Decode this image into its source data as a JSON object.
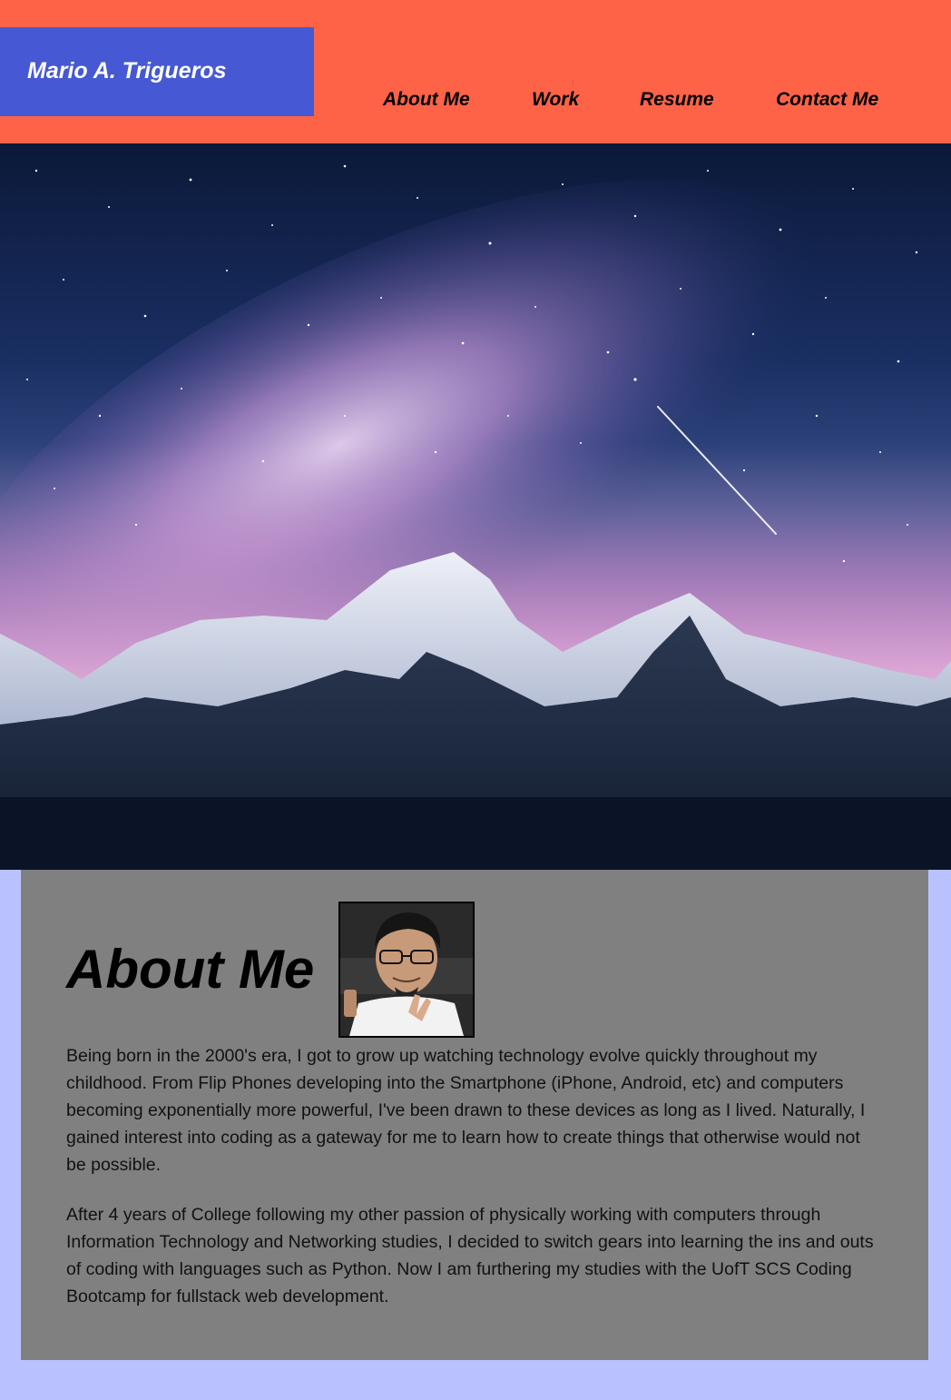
{
  "header": {
    "brand": "Mario A. Trigueros",
    "nav": [
      {
        "label": "About Me"
      },
      {
        "label": "Work"
      },
      {
        "label": "Resume"
      },
      {
        "label": "Contact Me"
      }
    ],
    "colors": {
      "header_bg": "#ff6347",
      "brand_bg": "#4658d3",
      "brand_text": "#ffffff",
      "nav_text": "#000000"
    }
  },
  "hero": {
    "image": "starry-night-mountains-image"
  },
  "about": {
    "title": "About Me",
    "avatar": "profile-photo",
    "paragraphs": [
      "Being born in the 2000's era, I got to grow up watching technology evolve quickly throughout my childhood. From Flip Phones developing into the Smartphone (iPhone, Android, etc) and computers becoming exponentially more powerful, I've been drawn to these devices as long as I lived. Naturally, I gained interest into coding as a gateway for me to learn how to create things that otherwise would not be possible.",
      "After 4 years of College following my other passion of physically working with computers through Information Technology and Networking studies, I decided to switch gears into learning the ins and outs of coding with languages such as Python. Now I am furthering my studies with the UofT SCS Coding Bootcamp for fullstack web development."
    ],
    "colors": {
      "panel_bg": "#808080",
      "page_bg": "#b9c2ff"
    }
  }
}
